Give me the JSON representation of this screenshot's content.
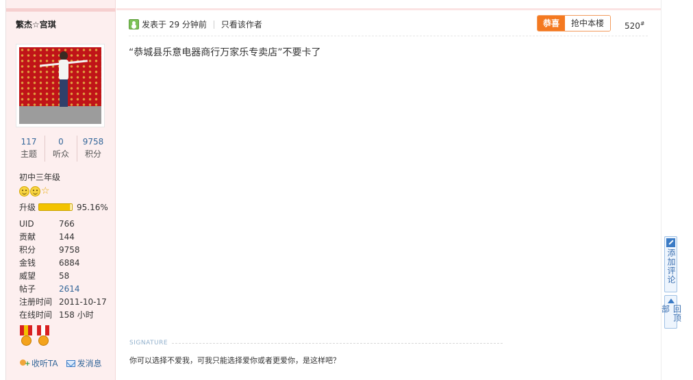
{
  "user": {
    "name": "繁杰☆宫琪",
    "stats": [
      {
        "value": "117",
        "label": "主题"
      },
      {
        "value": "0",
        "label": "听众"
      },
      {
        "value": "9758",
        "label": "积分"
      }
    ],
    "rank": "初中三年级",
    "upgrade_label": "升级",
    "upgrade_percent": "95.16%",
    "upgrade_fraction": 0.9516,
    "profile": [
      {
        "key": "UID",
        "value": "766"
      },
      {
        "key": "贡献",
        "value": "144"
      },
      {
        "key": "积分",
        "value": "9758"
      },
      {
        "key": "金钱",
        "value": "6884"
      },
      {
        "key": "威望",
        "value": "58"
      },
      {
        "key": "帖子",
        "value": "2614"
      },
      {
        "key": "注册时间",
        "value": "2011-10-17"
      },
      {
        "key": "在线时间",
        "value": "158 小时"
      }
    ],
    "follow_label": "收听TA",
    "message_label": "发消息"
  },
  "post": {
    "posted_at": "发表于 29 分钟前",
    "only_author": "只看该作者",
    "congrats_badge": "恭喜",
    "grab_floor": "抢中本楼",
    "floor_number": "520",
    "floor_suffix": "#",
    "body": "“恭城县乐意电器商行万家乐专卖店”不要卡了",
    "signature_label": "SIGNATURE",
    "signature_text": "你可以选择不爱我，可我只能选择爱你或者更爱你，是这样吧？"
  },
  "side": {
    "add_comment": "添加评论",
    "back_to_top": "回顶部"
  },
  "colors": {
    "sidebar_bg": "#fdefef",
    "link": "#336699",
    "badge_orange": "#f47920"
  }
}
